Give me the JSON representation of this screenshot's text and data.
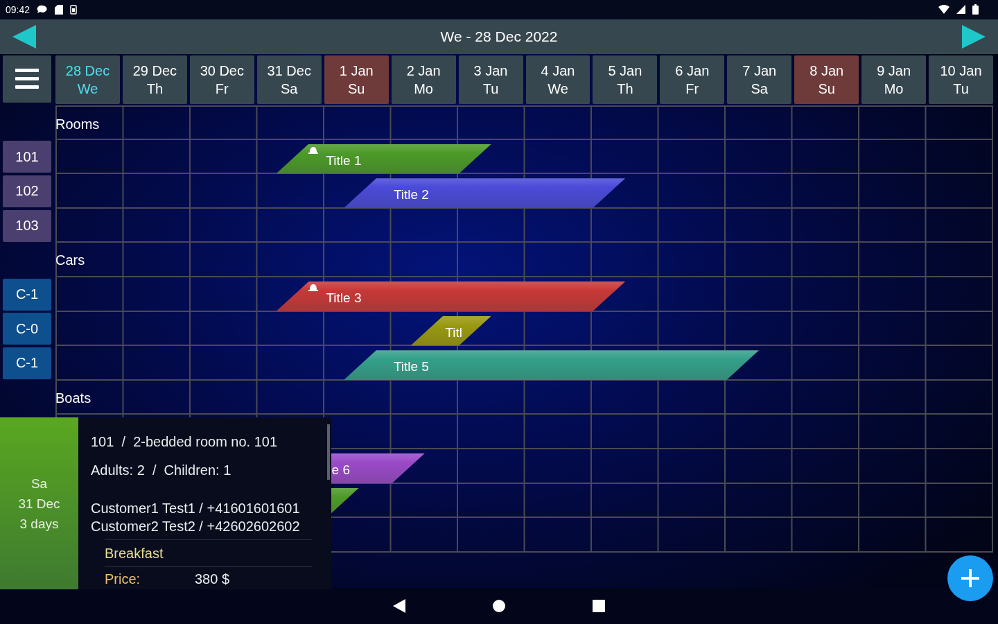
{
  "status_bar": {
    "time": "09:42"
  },
  "header": {
    "title": "We - 28 Dec 2022"
  },
  "days": [
    {
      "date": "28 Dec",
      "weekday": "We",
      "selected": true,
      "weekend": false
    },
    {
      "date": "29 Dec",
      "weekday": "Th",
      "selected": false,
      "weekend": false
    },
    {
      "date": "30 Dec",
      "weekday": "Fr",
      "selected": false,
      "weekend": false
    },
    {
      "date": "31 Dec",
      "weekday": "Sa",
      "selected": false,
      "weekend": false
    },
    {
      "date": "1 Jan",
      "weekday": "Su",
      "selected": false,
      "weekend": true
    },
    {
      "date": "2 Jan",
      "weekday": "Mo",
      "selected": false,
      "weekend": false
    },
    {
      "date": "3 Jan",
      "weekday": "Tu",
      "selected": false,
      "weekend": false
    },
    {
      "date": "4 Jan",
      "weekday": "We",
      "selected": false,
      "weekend": false
    },
    {
      "date": "5 Jan",
      "weekday": "Th",
      "selected": false,
      "weekend": false
    },
    {
      "date": "6 Jan",
      "weekday": "Fr",
      "selected": false,
      "weekend": false
    },
    {
      "date": "7 Jan",
      "weekday": "Sa",
      "selected": false,
      "weekend": false
    },
    {
      "date": "8 Jan",
      "weekday": "Su",
      "selected": false,
      "weekend": true
    },
    {
      "date": "9 Jan",
      "weekday": "Mo",
      "selected": false,
      "weekend": false
    },
    {
      "date": "10 Jan",
      "weekday": "Tu",
      "selected": false,
      "weekend": false
    }
  ],
  "rows": [
    {
      "kind": "section",
      "label": "Rooms"
    },
    {
      "kind": "resource",
      "label": "101",
      "color": "#4a3f6e",
      "bookings": [
        {
          "title": "Title 1",
          "color": "#4c9a28",
          "flagged": true
        }
      ]
    },
    {
      "kind": "resource",
      "label": "102",
      "color": "#4a3f6e",
      "bookings": [
        {
          "title": "Title 2",
          "color": "#4a4ad8",
          "flagged": false
        }
      ]
    },
    {
      "kind": "resource",
      "label": "103",
      "color": "#4a3f6e",
      "bookings": []
    },
    {
      "kind": "section",
      "label": "Cars"
    },
    {
      "kind": "resource",
      "label": "C-1",
      "color": "#0e4f8e",
      "bookings": [
        {
          "title": "Title 3",
          "color": "#c83838",
          "flagged": true
        }
      ]
    },
    {
      "kind": "resource",
      "label": "C-0",
      "color": "#0e4f8e",
      "bookings": [
        {
          "title": "Titl",
          "color": "#9a9a10",
          "flagged": false
        }
      ]
    },
    {
      "kind": "resource",
      "label": "C-1",
      "color": "#0e4f8e",
      "bookings": [
        {
          "title": "Title 5",
          "color": "#34a08a",
          "flagged": false
        }
      ]
    },
    {
      "kind": "section",
      "label": "Boats"
    },
    {
      "kind": "hidden",
      "bookings": []
    },
    {
      "kind": "hidden",
      "bookings": [
        {
          "title": "e 6",
          "color": "#9a4ac8",
          "flagged": false
        }
      ]
    },
    {
      "kind": "hidden",
      "bookings": [
        {
          "color": "#4c9a28"
        }
      ]
    },
    {
      "kind": "hidden",
      "bookings": []
    }
  ],
  "popup": {
    "weekday": "Sa",
    "date": "31 Dec",
    "duration": "3 days",
    "room": "101  /  2-bedded room no. 101",
    "guests": "Adults: 2  /  Children: 1",
    "customers": [
      "Customer1 Test1 / +41601601601",
      "Customer2 Test2 / +42602602602"
    ],
    "extra": "Breakfast",
    "price_label": "Price:",
    "price": "380  $"
  }
}
